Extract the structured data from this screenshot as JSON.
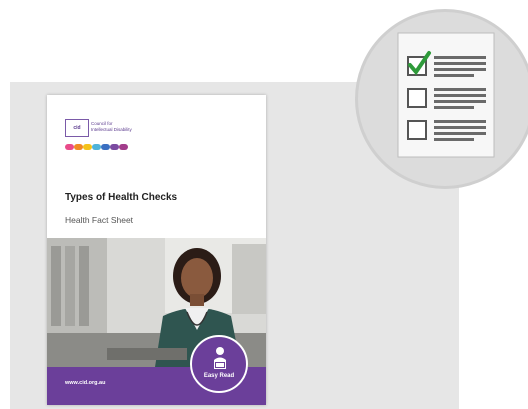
{
  "cover": {
    "logo_abbrev": "cid",
    "org_name_lines": [
      "Council for",
      "Intellectual Disability"
    ],
    "title": "Types of Health Checks",
    "subtitle": "Health Fact Sheet",
    "url": "www.cid.org.au",
    "badge_label": "Easy Read"
  },
  "icons": {
    "checklist": "checklist-icon",
    "easy_read": "person-reading-icon"
  },
  "colors": {
    "brand_purple": "#6b3f9a",
    "check_green": "#2e9a3a",
    "panel_gray": "#e6e6e6"
  }
}
